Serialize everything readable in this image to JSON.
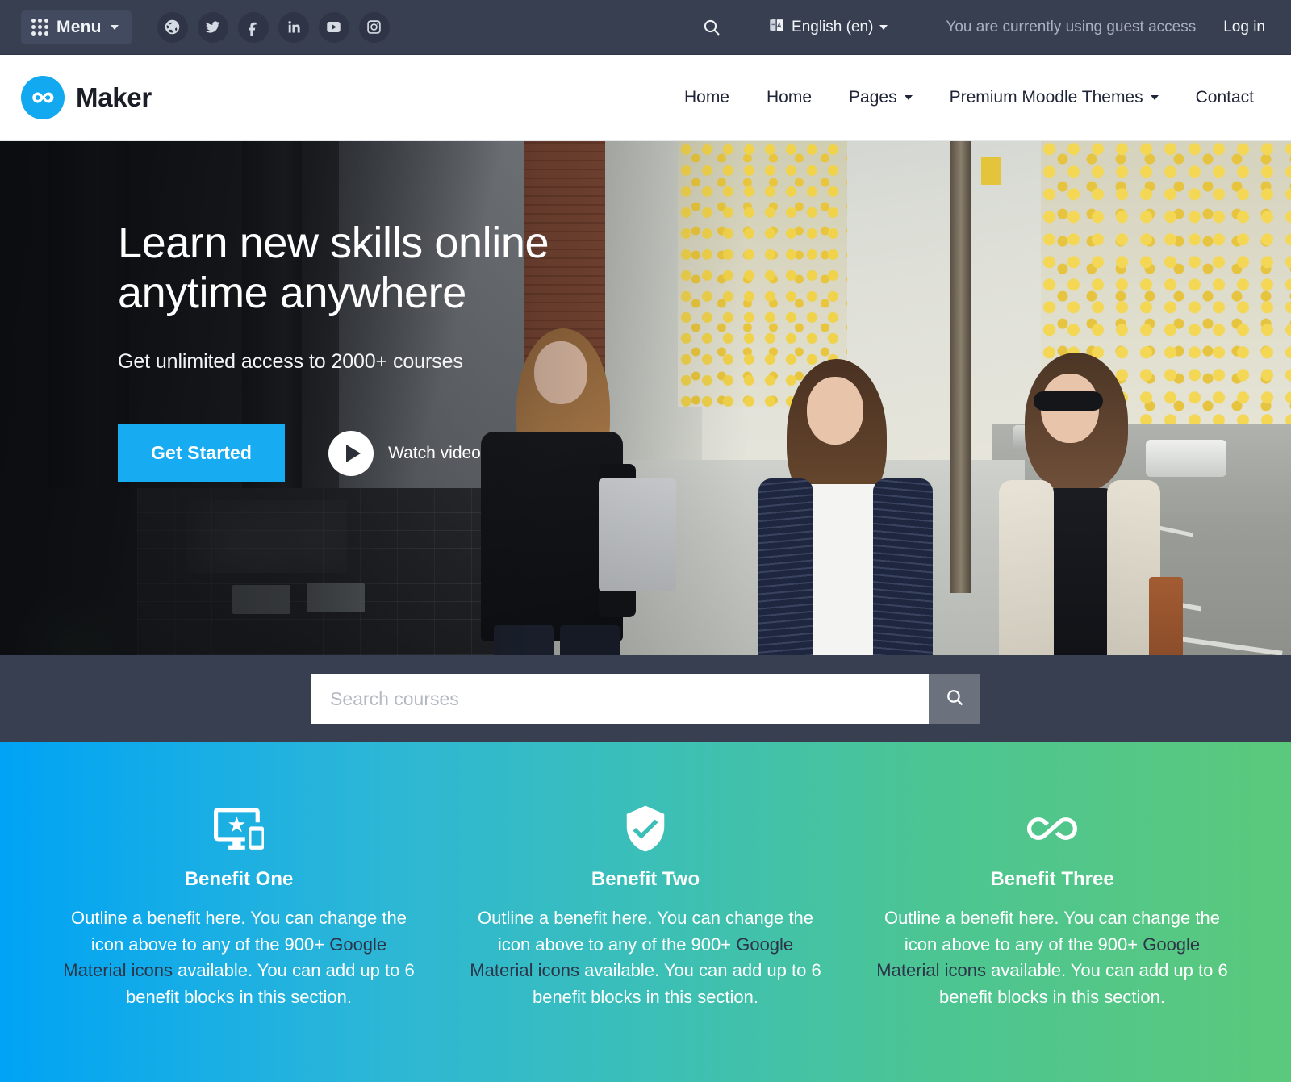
{
  "topbar": {
    "menu_label": "Menu",
    "menu_icon": "grid-apps-icon",
    "socials": [
      {
        "name": "globe-icon",
        "label": "Website"
      },
      {
        "name": "twitter-icon",
        "label": "Twitter"
      },
      {
        "name": "facebook-icon",
        "label": "Facebook"
      },
      {
        "name": "linkedin-icon",
        "label": "LinkedIn"
      },
      {
        "name": "youtube-icon",
        "label": "YouTube"
      },
      {
        "name": "instagram-icon",
        "label": "Instagram"
      }
    ],
    "search_icon": "search-icon",
    "language": "English (en)",
    "language_icon": "translate-icon",
    "guest_notice": "You are currently using guest access",
    "login_label": "Log in"
  },
  "navbar": {
    "brand_name": "Maker",
    "brand_icon": "infinity-logo-icon",
    "links": [
      {
        "label": "Home",
        "has_dropdown": false
      },
      {
        "label": "Home",
        "has_dropdown": false
      },
      {
        "label": "Pages",
        "has_dropdown": true
      },
      {
        "label": "Premium Moodle Themes",
        "has_dropdown": true
      },
      {
        "label": "Contact",
        "has_dropdown": false
      }
    ]
  },
  "hero": {
    "title": "Learn new skills online\nanytime anywhere",
    "subtitle": "Get unlimited access to 2000+ courses",
    "cta_label": "Get Started",
    "watch_label": "Watch video",
    "play_icon": "play-icon"
  },
  "search": {
    "placeholder": "Search courses",
    "value": "",
    "button_icon": "search-icon"
  },
  "benefits": [
    {
      "icon": "important-devices-icon",
      "title": "Benefit One",
      "text_before": "Outline a benefit here. You can change the icon above to any of the 900+ ",
      "link": "Google Material icons",
      "text_after": " available. You can add up to 6 benefit blocks in this section."
    },
    {
      "icon": "verified-user-shield-icon",
      "title": "Benefit Two",
      "text_before": "Outline a benefit here. You can change the icon above to any of the 900+ ",
      "link": "Google Material icons",
      "text_after": " available. You can add up to 6 benefit blocks in this section."
    },
    {
      "icon": "all-inclusive-infinity-icon",
      "title": "Benefit Three",
      "text_before": "Outline a benefit here. You can change the icon above to any of the 900+ ",
      "link": "Google Material icons",
      "text_after": " available. You can add up to 6 benefit blocks in this section."
    }
  ],
  "colors": {
    "topbar_bg": "#383f51",
    "brand_blue": "#12a9f0",
    "cta_blue": "#17abf1",
    "gradient_start": "#00a3f5",
    "gradient_end": "#5bc97c",
    "search_button": "#6b727e"
  }
}
